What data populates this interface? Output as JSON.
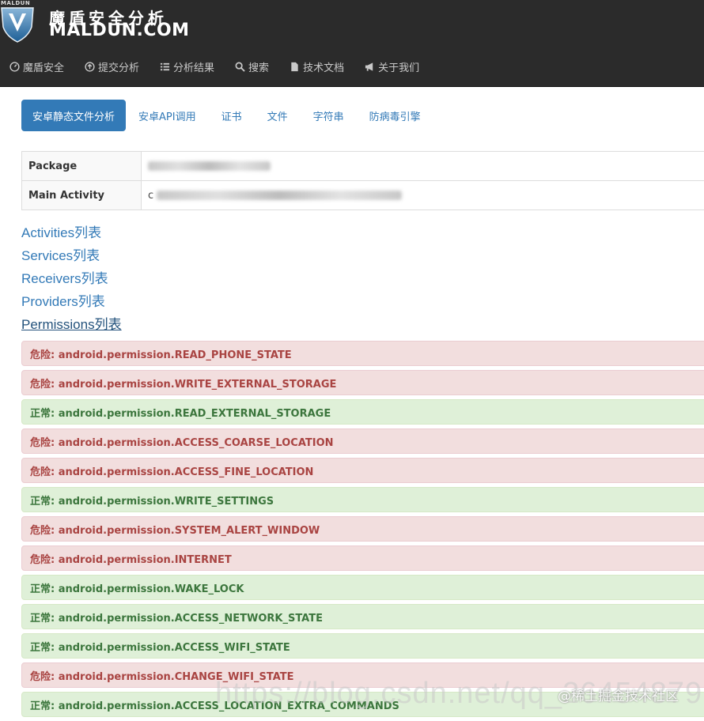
{
  "brand": {
    "logo_small": "MALDUN",
    "name_cn": "魔盾安全分析",
    "name_en": "MALDUN.COM"
  },
  "nav": [
    {
      "label": "魔盾安全",
      "icon": "dashboard-icon"
    },
    {
      "label": "提交分析",
      "icon": "upload-icon"
    },
    {
      "label": "分析结果",
      "icon": "list-icon"
    },
    {
      "label": "搜索",
      "icon": "search-icon"
    },
    {
      "label": "技术文档",
      "icon": "document-icon"
    },
    {
      "label": "关于我们",
      "icon": "megaphone-icon"
    }
  ],
  "tabs": [
    {
      "label": "安卓静态文件分析",
      "active": true
    },
    {
      "label": "安卓API调用",
      "active": false
    },
    {
      "label": "证书",
      "active": false
    },
    {
      "label": "文件",
      "active": false
    },
    {
      "label": "字符串",
      "active": false
    },
    {
      "label": "防病毒引擎",
      "active": false
    }
  ],
  "info": [
    {
      "key": "Package",
      "value": ""
    },
    {
      "key": "Main Activity",
      "value": "c"
    }
  ],
  "links": [
    {
      "label": "Activities列表"
    },
    {
      "label": "Services列表"
    },
    {
      "label": "Receivers列表"
    },
    {
      "label": "Providers列表"
    },
    {
      "label": "Permissions列表"
    }
  ],
  "permissions": [
    {
      "text": "危险: android.permission.READ_PHONE_STATE",
      "level": "danger"
    },
    {
      "text": "危险: android.permission.WRITE_EXTERNAL_STORAGE",
      "level": "danger"
    },
    {
      "text": "正常: android.permission.READ_EXTERNAL_STORAGE",
      "level": "success"
    },
    {
      "text": "危险: android.permission.ACCESS_COARSE_LOCATION",
      "level": "danger"
    },
    {
      "text": "危险: android.permission.ACCESS_FINE_LOCATION",
      "level": "danger"
    },
    {
      "text": "正常: android.permission.WRITE_SETTINGS",
      "level": "success"
    },
    {
      "text": "危险: android.permission.SYSTEM_ALERT_WINDOW",
      "level": "danger"
    },
    {
      "text": "危险: android.permission.INTERNET",
      "level": "danger"
    },
    {
      "text": "正常: android.permission.WAKE_LOCK",
      "level": "success"
    },
    {
      "text": "正常: android.permission.ACCESS_NETWORK_STATE",
      "level": "success"
    },
    {
      "text": "正常: android.permission.ACCESS_WIFI_STATE",
      "level": "success"
    },
    {
      "text": "危险: android.permission.CHANGE_WIFI_STATE",
      "level": "danger"
    },
    {
      "text": "正常: android.permission.ACCESS_LOCATION_EXTRA_COMMANDS",
      "level": "success"
    }
  ],
  "watermark": {
    "url": "https://blog.csdn.net/qq_26454879",
    "brand": "@稀土掘金技术社区"
  },
  "colors": {
    "header_bg": "#2b2b2b",
    "accent": "#337ab7",
    "danger_bg": "#f2dede",
    "danger_text": "#a94442",
    "success_bg": "#dff0d8",
    "success_text": "#3c763d"
  }
}
